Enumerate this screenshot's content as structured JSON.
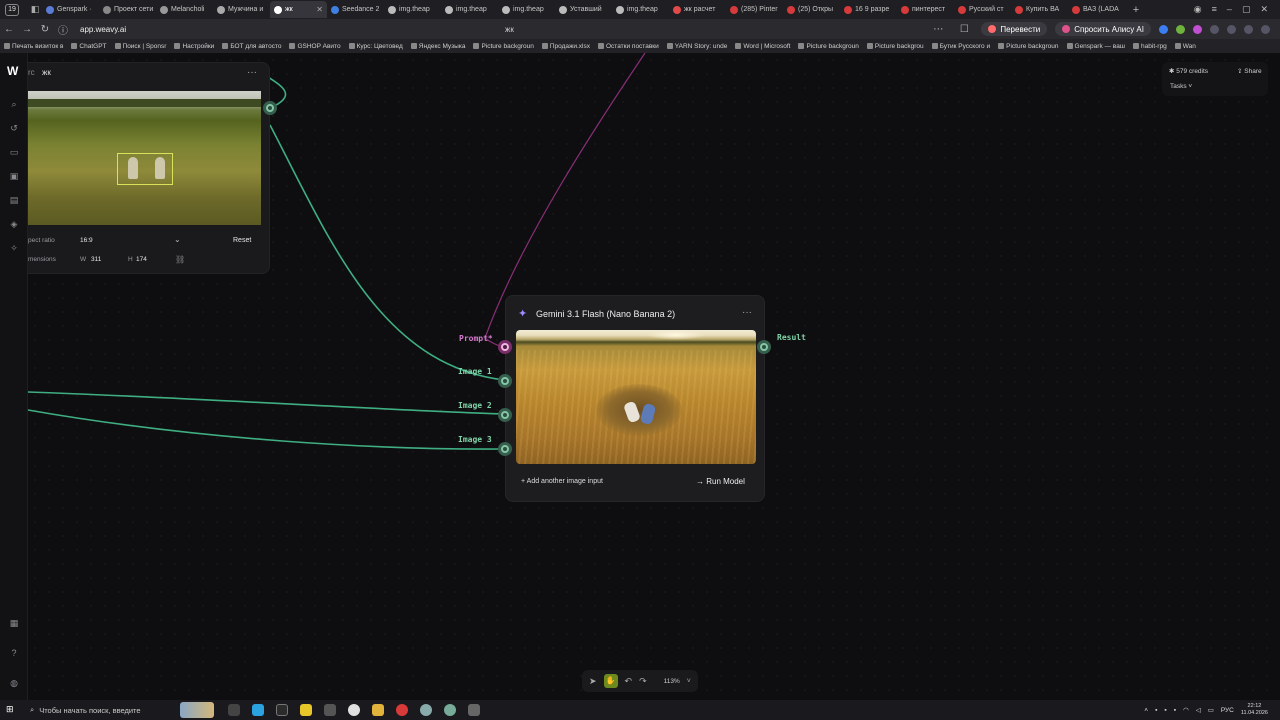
{
  "browser": {
    "tab_count": "19",
    "tabs": [
      {
        "label": "Genspark ·",
        "color": "#5a7bd6",
        "active": false
      },
      {
        "label": "Проект сети",
        "color": "#888888",
        "active": false
      },
      {
        "label": "Melancholi",
        "color": "#999999",
        "active": false
      },
      {
        "label": "Мужчина и",
        "color": "#aaaaaa",
        "active": false
      },
      {
        "label": "жк",
        "color": "#ffffff",
        "active": true
      },
      {
        "label": "Seedance 2",
        "color": "#3f7fe0",
        "active": false
      },
      {
        "label": "img.theap",
        "color": "#bbbbbb",
        "active": false
      },
      {
        "label": "img.theap",
        "color": "#bbbbbb",
        "active": false
      },
      {
        "label": "img.theap",
        "color": "#bbbbbb",
        "active": false
      },
      {
        "label": "Уставший",
        "color": "#bbbbbb",
        "active": false
      },
      {
        "label": "img.theap",
        "color": "#bbbbbb",
        "active": false
      },
      {
        "label": "жк расчет",
        "color": "#e04a4a",
        "active": false
      },
      {
        "label": "(285) Pinter",
        "color": "#d63a3a",
        "active": false
      },
      {
        "label": "(25) Откры",
        "color": "#d63a3a",
        "active": false
      },
      {
        "label": "16 9 разре",
        "color": "#d63a3a",
        "active": false
      },
      {
        "label": "пинтерест",
        "color": "#d63a3a",
        "active": false
      },
      {
        "label": "Русский ст",
        "color": "#d63a3a",
        "active": false
      },
      {
        "label": "Купить ВА",
        "color": "#d63a3a",
        "active": false
      },
      {
        "label": "ВАЗ (LADA",
        "color": "#d63a3a",
        "active": false
      }
    ],
    "url": "app.weavy.ai",
    "page_title": "жк",
    "translate_label": "Перевести",
    "alice_label": "Спросить Алису AI",
    "bookmarks": [
      "Печать визиток в",
      "ChatGPT",
      "Поиск | Sponsr",
      "Настройки",
      "БОТ для автосто",
      "GSHOP Авито",
      "Курс: Цветовед",
      "Яндекс Музыка",
      "Picture backgroun",
      "Продажи.xlsx",
      "Остатки поставки",
      "YARN Story: unde",
      "Word | Microsoft",
      "Picture backgroun",
      "Picture backgrou",
      "Бутик Русского и",
      "Picture backgroun",
      "Genspark — ваш",
      "habit-rpg",
      "Wan"
    ]
  },
  "crop_node": {
    "title_prefix": "rc",
    "title": "жк",
    "menu": "···",
    "aspect_label": "pect ratio",
    "aspect_value": "16:9",
    "reset_label": "Reset",
    "dimensions_label": "mensions",
    "w_label": "W",
    "w_value": "311",
    "h_label": "H",
    "h_value": "174"
  },
  "gemini_node": {
    "title": "Gemini 3.1 Flash (Nano Banana 2)",
    "menu": "···",
    "inputs": [
      {
        "label": "Prompt*",
        "color": "#d77bd0"
      },
      {
        "label": "Image 1",
        "color": "#7fd3a8"
      },
      {
        "label": "Image 2",
        "color": "#7fd3a8"
      },
      {
        "label": "Image 3",
        "color": "#7fd3a8"
      }
    ],
    "output_label": "Result",
    "add_input_label": "+ Add another image input",
    "run_label": "→ Run Model"
  },
  "top_right": {
    "credits": "✱ 579 credits",
    "share": "⇪ Share",
    "tasks": "Tasks ˅"
  },
  "toolbar": {
    "zoom": "113%",
    "zoom_chevron": "˅"
  },
  "taskbar": {
    "search_placeholder": "Чтобы начать поиск, введите",
    "lang": "РУС",
    "time": "22:12",
    "date": "11.04.2026"
  },
  "colors": {
    "wire_green": "#3fae82",
    "wire_pink": "#b0409a",
    "accent_green": "#6d8a1e"
  }
}
